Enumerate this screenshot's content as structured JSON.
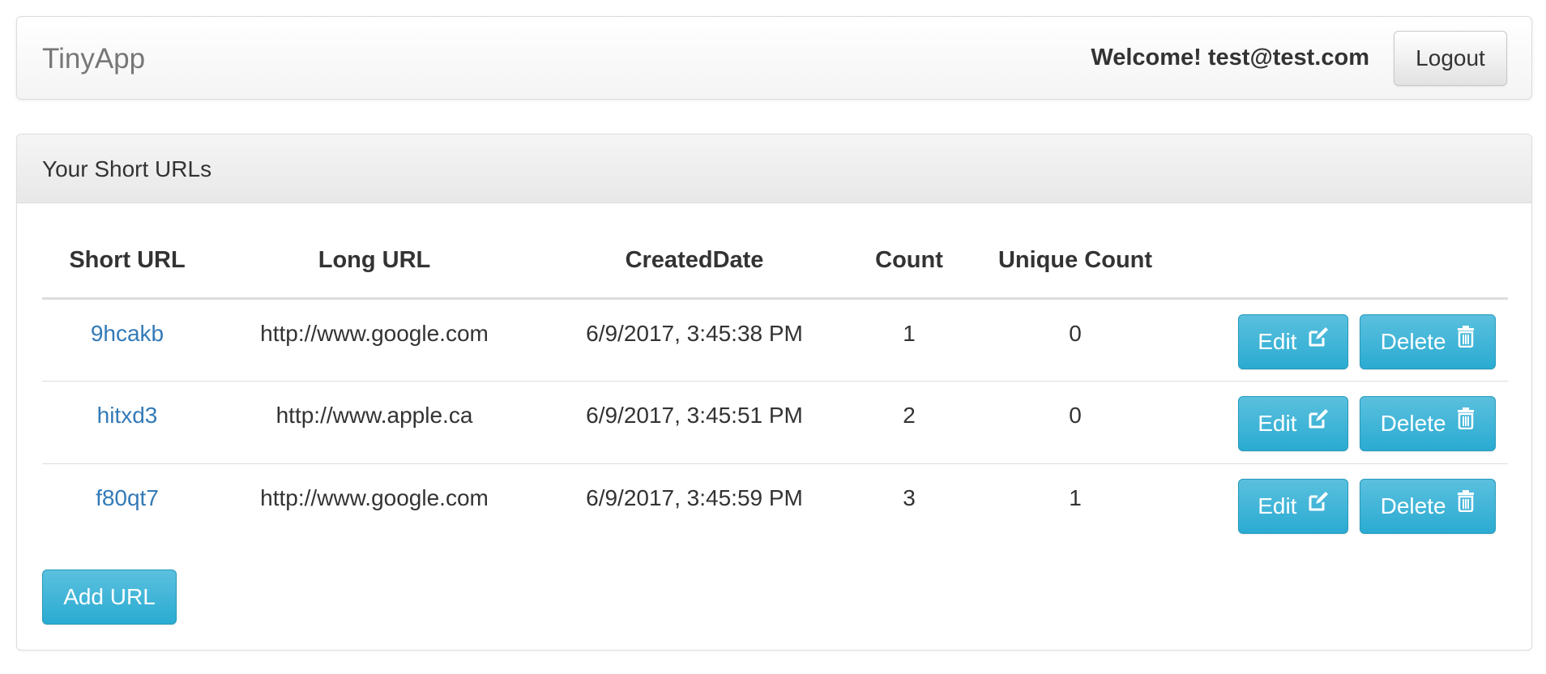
{
  "navbar": {
    "brand": "TinyApp",
    "welcome": "Welcome! test@test.com",
    "logout_label": "Logout"
  },
  "panel": {
    "title": "Your Short URLs"
  },
  "table": {
    "headers": {
      "short_url": "Short URL",
      "long_url": "Long URL",
      "created_date": "CreatedDate",
      "count": "Count",
      "unique_count": "Unique Count"
    },
    "rows": [
      {
        "short_url": "9hcakb",
        "long_url": "http://www.google.com",
        "created_date": "6/9/2017, 3:45:38 PM",
        "count": "1",
        "unique_count": "0"
      },
      {
        "short_url": "hitxd3",
        "long_url": "http://www.apple.ca",
        "created_date": "6/9/2017, 3:45:51 PM",
        "count": "2",
        "unique_count": "0"
      },
      {
        "short_url": "f80qt7",
        "long_url": "http://www.google.com",
        "created_date": "6/9/2017, 3:45:59 PM",
        "count": "3",
        "unique_count": "1"
      }
    ],
    "edit_label": "Edit",
    "delete_label": "Delete"
  },
  "add_button_label": "Add URL",
  "colors": {
    "info_button": "#2aabd2",
    "link": "#337ab7"
  },
  "icons": {
    "edit": "edit-icon",
    "delete": "trash-icon"
  }
}
